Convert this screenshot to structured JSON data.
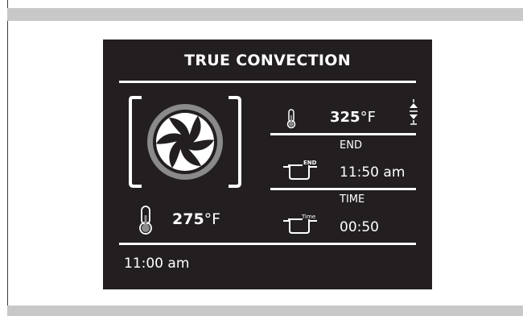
{
  "screen": {
    "title": "TRUE CONVECTION",
    "set_temp": {
      "value": "325",
      "unit": "°F"
    },
    "end": {
      "label": "END",
      "time": "11:50 am",
      "icon_text": "END"
    },
    "duration": {
      "label": "TIME",
      "time": "00:50",
      "icon_text": "Time"
    },
    "current_temp": {
      "value": "275",
      "unit": "°F"
    },
    "clock": "11:00 am"
  },
  "icons": {
    "mode": "convection-fan-icon",
    "set_temp": "thermometer-icon",
    "adjust": "up-down-arrows-icon",
    "end": "pot-end-icon",
    "duration": "pot-timer-icon",
    "current_temp": "thermometer-icon"
  },
  "colors": {
    "panel_bg": "#231f20",
    "text": "#ffffff",
    "accent_gray": "#8a8a8a",
    "bar_gray": "#c8c8c8"
  }
}
